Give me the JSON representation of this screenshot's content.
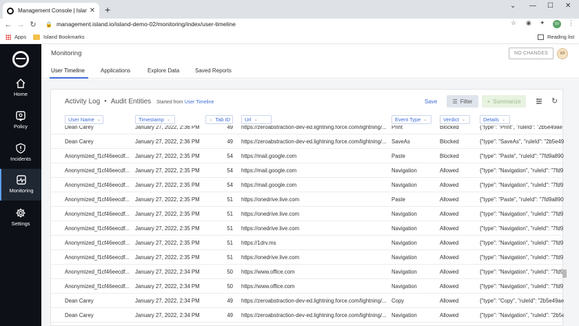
{
  "browser": {
    "tab_title": "Management Console | Island",
    "url": "management.island.io/island-demo-02/monitoring/index/user-timeline",
    "profile_initials": "SV",
    "bookmarks": [
      "Apps",
      "Island Bookmarks"
    ],
    "reading_list": "Reading list"
  },
  "sidebar": {
    "items": [
      {
        "label": "Home",
        "icon": "home-icon"
      },
      {
        "label": "Policy",
        "icon": "policy-icon"
      },
      {
        "label": "Incidents",
        "icon": "alert-icon"
      },
      {
        "label": "Monitoring",
        "icon": "monitoring-icon"
      },
      {
        "label": "Settings",
        "icon": "gear-icon"
      }
    ]
  },
  "header": {
    "title": "Monitoring",
    "no_changes": "NO CHANGES",
    "user_initials": "WI"
  },
  "tabs": [
    "User Timeline",
    "Applications",
    "Explore Data",
    "Saved Reports"
  ],
  "panel": {
    "crumb1": "Activity Log",
    "crumb2": "Audit Entities",
    "started_prefix": "Started from",
    "started_link": "User Timeline",
    "save": "Save",
    "filter": "Filter",
    "summarize": "Summarize"
  },
  "table": {
    "columns": [
      "User Name",
      "Timestamp",
      "Tab ID",
      "Url",
      "Event Type",
      "Verdict",
      "Details"
    ],
    "rows": [
      [
        "Dean Carey",
        "January 27, 2022, 2:36 PM",
        "49",
        "https://zeroabstraction-dev-ed.lightning.force.com/lightning/...",
        "Print",
        "Blocked",
        "{\"type\": \"Print\", \"ruleId\": \"2b5e49ae"
      ],
      [
        "Dean Carey",
        "January 27, 2022, 2:36 PM",
        "49",
        "https://zeroabstraction-dev-ed.lightning.force.com/lightning/...",
        "SaveAs",
        "Blocked",
        "{\"type\": \"SaveAs\", \"ruleId\": \"2b5e49a"
      ],
      [
        "Anonymized_f1cf46eecdf...",
        "January 27, 2022, 2:35 PM",
        "54",
        "https://mail.google.com",
        "Paste",
        "Blocked",
        "{\"type\": \"Paste\", \"ruleId\": \"7fd9a890"
      ],
      [
        "Anonymized_f1cf46eecdf...",
        "January 27, 2022, 2:35 PM",
        "54",
        "https://mail.google.com",
        "Navigation",
        "Allowed",
        "{\"type\": \"Navigation\", \"ruleId\": \"7fd9"
      ],
      [
        "Anonymized_f1cf46eecdf...",
        "January 27, 2022, 2:35 PM",
        "54",
        "https://mail.google.com",
        "Navigation",
        "Allowed",
        "{\"type\": \"Navigation\", \"ruleId\": \"7fd9"
      ],
      [
        "Anonymized_f1cf46eecdf...",
        "January 27, 2022, 2:35 PM",
        "51",
        "https://onedrive.live.com",
        "Paste",
        "Allowed",
        "{\"type\": \"Paste\", \"ruleId\": \"7fd9a890"
      ],
      [
        "Anonymized_f1cf46eecdf...",
        "January 27, 2022, 2:35 PM",
        "51",
        "https://onedrive.live.com",
        "Navigation",
        "Allowed",
        "{\"type\": \"Navigation\", \"ruleId\": \"7fd9"
      ],
      [
        "Anonymized_f1cf46eecdf...",
        "January 27, 2022, 2:35 PM",
        "51",
        "https://onedrive.live.com",
        "Navigation",
        "Allowed",
        "{\"type\": \"Navigation\", \"ruleId\": \"7fd9"
      ],
      [
        "Anonymized_f1cf46eecdf...",
        "January 27, 2022, 2:35 PM",
        "51",
        "https://1drv.ms",
        "Navigation",
        "Allowed",
        "{\"type\": \"Navigation\", \"ruleId\": \"7fd9"
      ],
      [
        "Anonymized_f1cf46eecdf...",
        "January 27, 2022, 2:35 PM",
        "51",
        "https://onedrive.live.com",
        "Navigation",
        "Allowed",
        "{\"type\": \"Navigation\", \"ruleId\": \"7fd9"
      ],
      [
        "Anonymized_f1cf46eecdf...",
        "January 27, 2022, 2:34 PM",
        "50",
        "https://www.office.com",
        "Navigation",
        "Allowed",
        "{\"type\": \"Navigation\", \"ruleId\": \"7fd9"
      ],
      [
        "Anonymized_f1cf46eecdf...",
        "January 27, 2022, 2:34 PM",
        "50",
        "https://www.office.com",
        "Navigation",
        "Allowed",
        "{\"type\": \"Navigation\", \"ruleId\": \"7fd9"
      ],
      [
        "Dean Carey",
        "January 27, 2022, 2:34 PM",
        "49",
        "https://zeroabstraction-dev-ed.lightning.force.com/lightning/...",
        "Copy",
        "Allowed",
        "{\"type\": \"Copy\", \"ruleId\": \"2b5e49ae"
      ],
      [
        "Dean Carey",
        "January 27, 2022, 2:34 PM",
        "49",
        "https://zeroabstraction-dev-ed.lightning.force.com/lightning/...",
        "Navigation",
        "Allowed",
        "{\"type\": \"Navigation\", \"ruleId\": \"2b5e"
      ]
    ]
  }
}
